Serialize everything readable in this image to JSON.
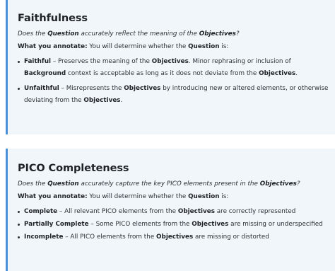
{
  "sections": [
    {
      "title": "Faithfulness",
      "question": {
        "t1": "Does the ",
        "b1": "Question",
        "t2": " accurately reflect the meaning of the ",
        "b2": "Objectives",
        "t3": "?"
      },
      "annotate": {
        "label": "What you annotate:",
        "t1": " You will determine whether the ",
        "b1": "Question",
        "t2": " is:"
      },
      "options": [
        {
          "term": "Faithful",
          "t1": " – Preserves the meaning of the ",
          "b1": "Objectives",
          "t2": ". Minor rephrasing or inclusion of ",
          "b2": "Background",
          "t3": " context is acceptable as long as it does not deviate from the ",
          "b3": "Objectives",
          "t4": "."
        },
        {
          "term": "Unfaithful",
          "t1": " – Misrepresents the ",
          "b1": "Objectives",
          "t2": " by introducing new or altered elements, or otherwise deviating from the ",
          "b2": "Objectives",
          "t3": "."
        }
      ]
    },
    {
      "title": "PICO Completeness",
      "question": {
        "t1": "Does the ",
        "b1": "Question",
        "t2": " accurately capture the key PICO elements present in the ",
        "b2": "Objectives",
        "t3": "?"
      },
      "annotate": {
        "label": "What you annotate:",
        "t1": " You will determine whether the ",
        "b1": "Question",
        "t2": " is:"
      },
      "options": [
        {
          "term": "Complete",
          "t1": " – All relevant PICO elements from the ",
          "b1": "Objectives",
          "t2": " are correctly represented"
        },
        {
          "term": "Partially Complete",
          "t1": " – Some PICO elements from the ",
          "b1": "Objectives",
          "t2": " are missing or underspecified"
        },
        {
          "term": "Incomplete",
          "t1": " – All PICO elements from the ",
          "b1": "Objectives",
          "t2": " are missing or distorted"
        }
      ]
    }
  ]
}
